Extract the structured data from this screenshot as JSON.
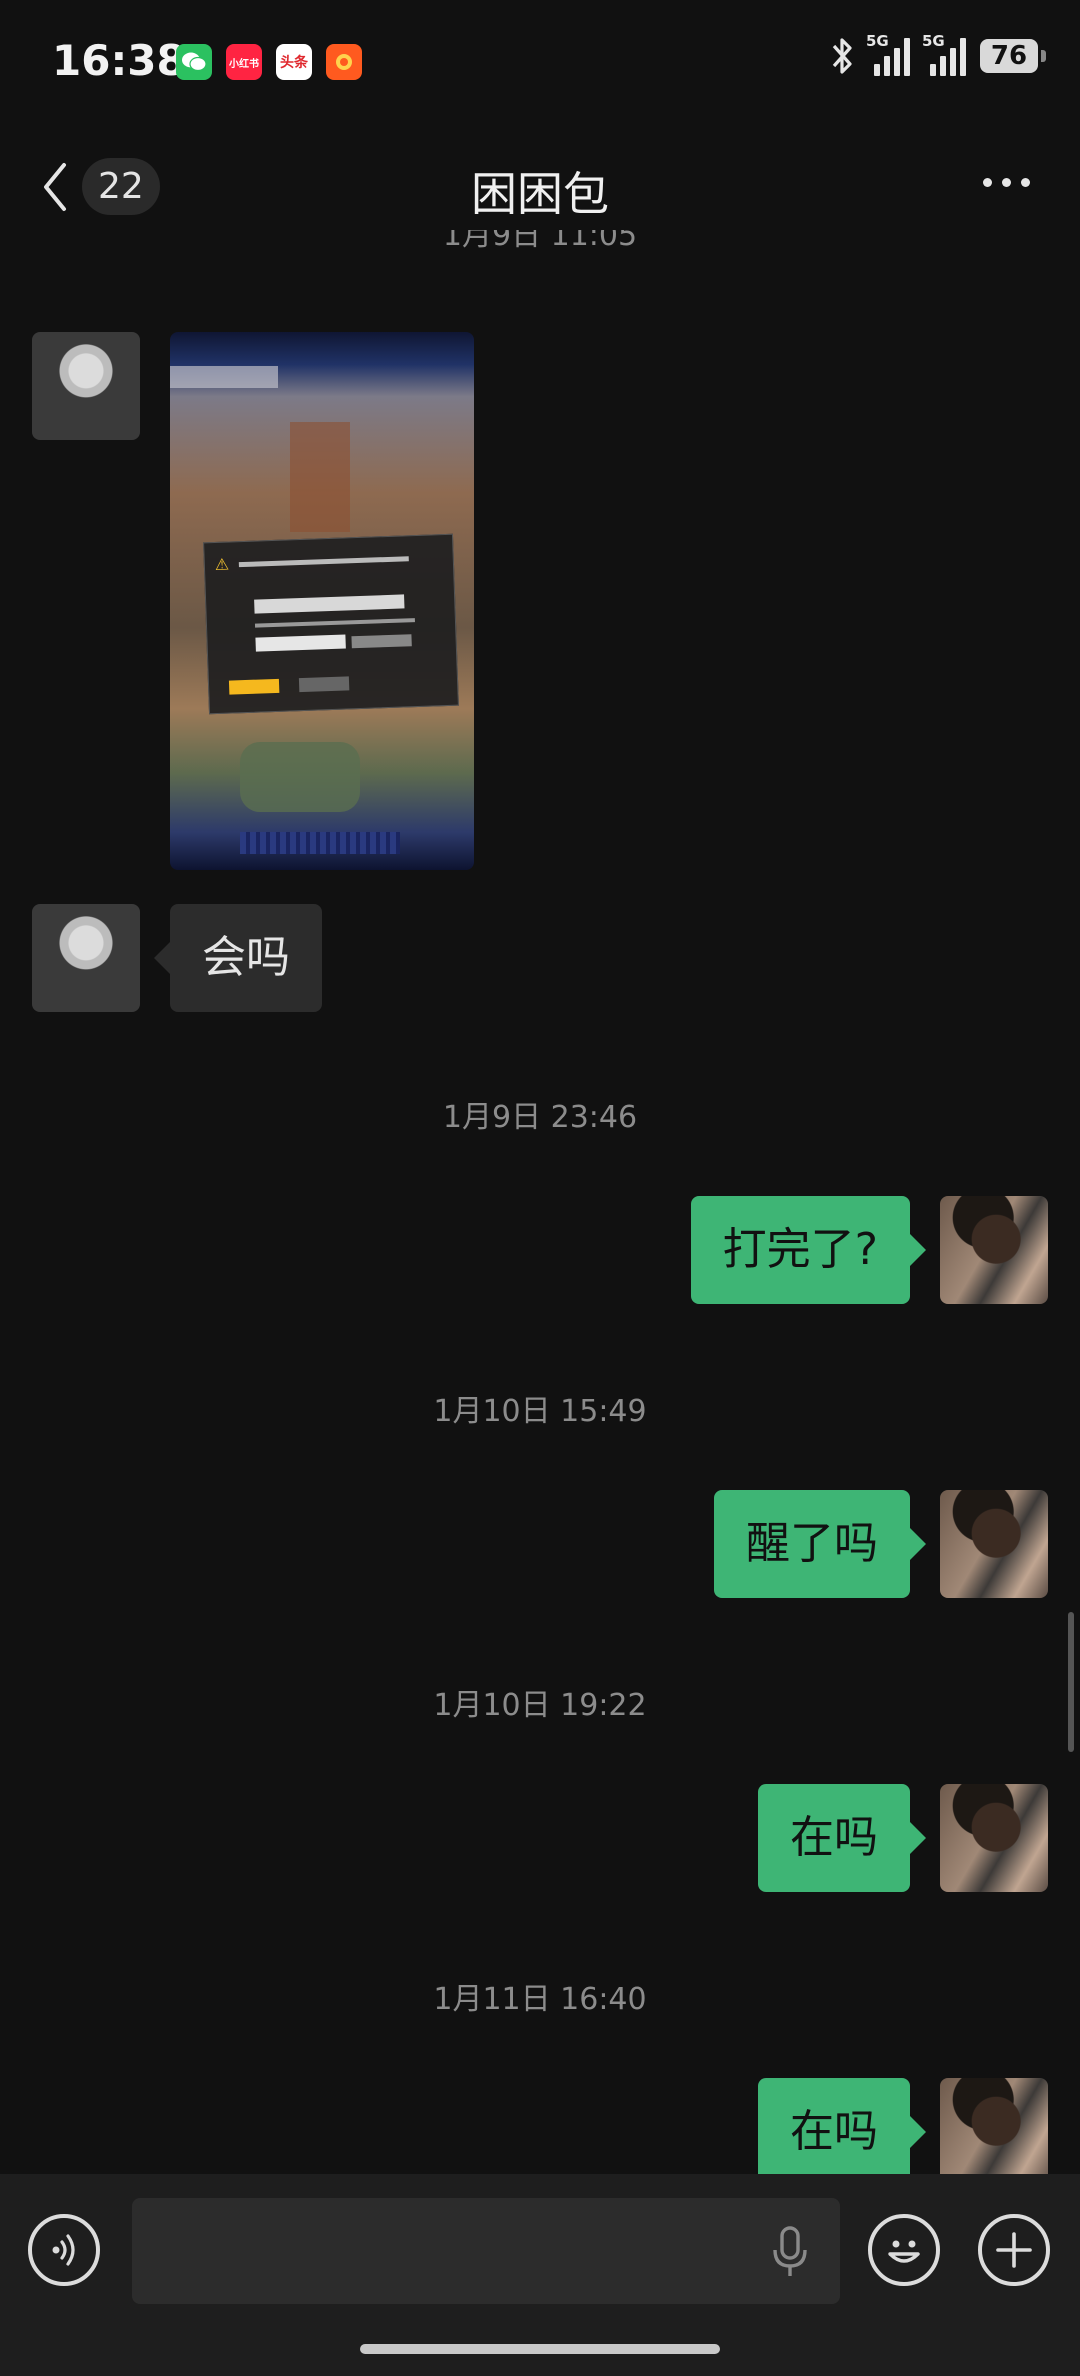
{
  "status_bar": {
    "time": "16:38",
    "apps": [
      {
        "name": "wechat-app-icon",
        "label": ""
      },
      {
        "name": "xiaohongshu-app-icon",
        "label": "小红书"
      },
      {
        "name": "toutiao-app-icon",
        "label": "头条"
      },
      {
        "name": "orange-app-icon",
        "label": ""
      }
    ],
    "signal1_label": "5G",
    "signal2_label": "5G",
    "battery": "76"
  },
  "header": {
    "back_count": "22",
    "title": "困困包"
  },
  "chat": {
    "partial_timestamp": "1月9日 11:05",
    "timestamps": [
      "1月9日 23:46",
      "1月10日 15:49",
      "1月10日 19:22",
      "1月11日 16:40"
    ],
    "messages": [
      {
        "side": "left",
        "type": "image"
      },
      {
        "side": "left",
        "type": "text",
        "text": "会吗"
      },
      {
        "side": "right",
        "type": "text",
        "text": "打完了?"
      },
      {
        "side": "right",
        "type": "text",
        "text": "醒了吗"
      },
      {
        "side": "right",
        "type": "text",
        "text": "在吗"
      },
      {
        "side": "right",
        "type": "text",
        "text": "在吗"
      }
    ]
  },
  "input_bar": {
    "placeholder": "",
    "icons": [
      "voice-icon",
      "mic-icon",
      "emoji-icon",
      "plus-icon"
    ]
  },
  "colors": {
    "background": "#111111",
    "outgoing_bubble": "#3eb575",
    "incoming_bubble": "#2c2c2c",
    "timestamp": "#8c8c8c"
  }
}
